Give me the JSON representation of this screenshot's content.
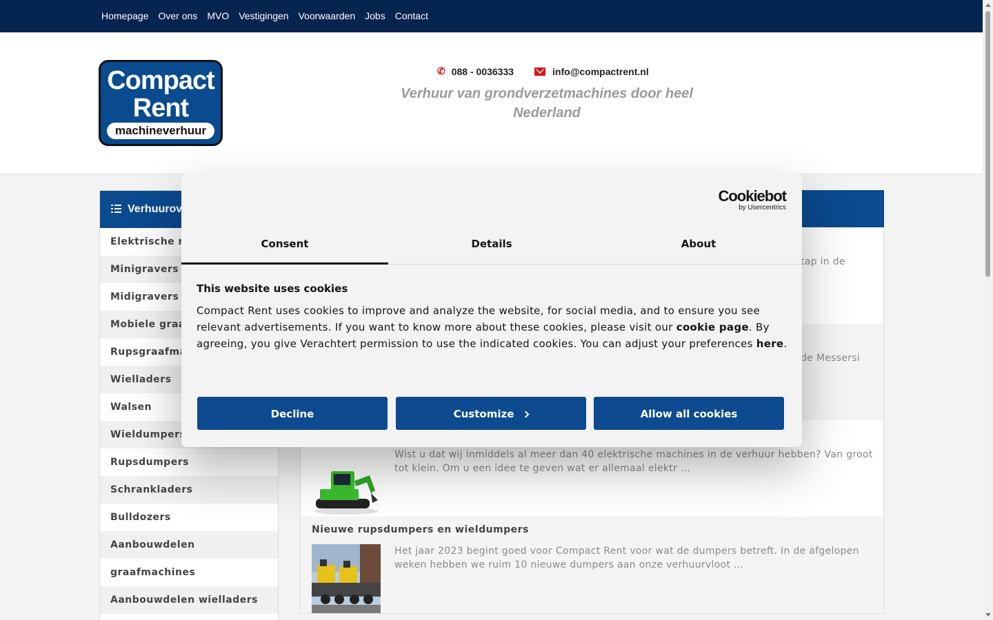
{
  "nav": {
    "items": [
      "Homepage",
      "Over ons",
      "MVO",
      "Vestigingen",
      "Voorwaarden",
      "Jobs",
      "Contact"
    ]
  },
  "header": {
    "logo": {
      "line1": "Compact",
      "line2": "Rent",
      "line3": "machineverhuur"
    },
    "phone": "088 - 0036333",
    "email": "info@compactrent.nl",
    "tagline": "Verhuur van grondverzetmachines door heel Nederland"
  },
  "sidebar": {
    "title": "Verhuurov",
    "items": [
      "Elektrische m",
      "Minigravers",
      "Midigravers",
      "Mobiele graa",
      "Rupsgraafma",
      "Wielladers",
      "Walsen",
      "Wieldumpers",
      "Rupsdumpers",
      "Schrankladers",
      "Bulldozers",
      "Aanbouwdelen",
      "graafmachines",
      "Aanbouwdelen wielladers"
    ]
  },
  "news": {
    "clip1": "tap in de",
    "clip2": "de Messersi",
    "item3_text": "Wist u dat wij inmiddels al meer dan 40 elektrische machines in de verhuur hebben? Van groot tot klein. Om u een idee te geven wat er allemaal elektr ...",
    "item4_title": "Nieuwe rupsdumpers en wieldumpers",
    "item4_text": "Het jaar 2023 begint goed voor Compact Rent voor wat de dumpers betreft. In de afgelopen weken hebben we ruim 10 nieuwe dumpers aan onze verhuurvloot ..."
  },
  "cookie": {
    "brand": "Cookiebot",
    "brand_sub": "by Usercentrics",
    "tabs": [
      "Consent",
      "Details",
      "About"
    ],
    "title": "This website uses cookies",
    "body_1": "Compact Rent uses cookies to improve and analyze the website, for social media, and to ensure you see relevant advertisements. If you want to know more about these cookies, please visit our ",
    "link_1": "cookie page",
    "body_2": ". By agreeing, you give Verachtert permission to use the indicated cookies. You can adjust your preferences ",
    "link_2": "here",
    "body_3": ".",
    "buttons": {
      "decline": "Decline",
      "customize": "Customize",
      "allow": "Allow all cookies"
    }
  },
  "colors": {
    "navy": "#062450",
    "brand_blue": "#0a4a8f",
    "accent_red": "#d9141b",
    "cookie_button": "#0d4a90"
  }
}
